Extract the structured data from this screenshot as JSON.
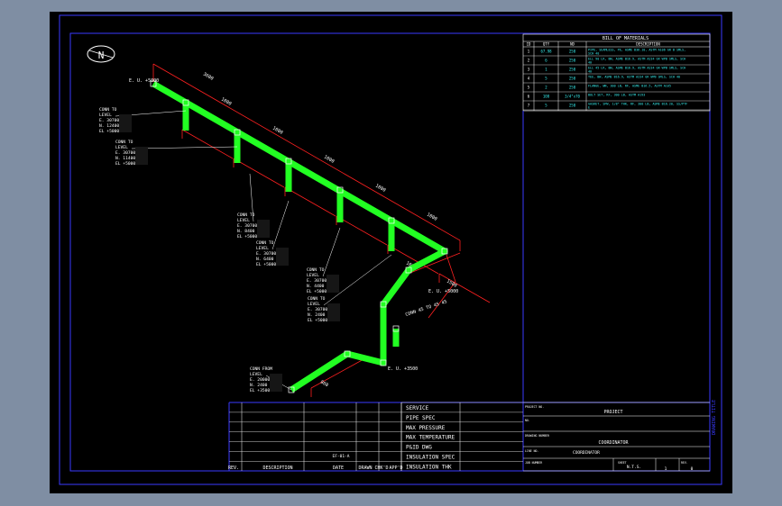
{
  "colors": {
    "background": "#000000",
    "frame": "#3a3aff",
    "pipe": "#22ff22",
    "dimension": "#ff2020",
    "text": "#ffffff",
    "bom_text": "#38f0f0"
  },
  "north_label": "N",
  "bom": {
    "title": "BILL OF MATERIALS",
    "headers": [
      "ID",
      "QTY",
      "ND",
      "DESCRIPTION"
    ],
    "rows": [
      [
        "1",
        "67.98",
        "250",
        "PIPE, SEAMLESS, PE, ASME B36.10, ASTM A106 GR B SMLS, SCH 40"
      ],
      [
        "2",
        "6",
        "250",
        "ELL 90 LR, BW, ASME B16.9, ASTM A234 GR WPB SMLS, SCH 40"
      ],
      [
        "3",
        "1",
        "250",
        "ELL 45 LR, BW, ASME B16.9, ASTM A234 GR WPB SMLS, SCH 40"
      ],
      [
        "4",
        "5",
        "250",
        "TEE, BW, ASME B16.9, ASTM A234 GR WPB SMLS, SCH 40"
      ],
      [
        "5",
        "2",
        "250",
        "FLANGE, WN, 300 LB, RF, ASME B16.5, ASTM A105"
      ],
      [
        "6",
        "108",
        "3/4\"x70",
        "BOLT SET, RF, 300 LB, ASTM A193"
      ],
      [
        "7",
        "5",
        "250",
        "GASKET, SPW, 1/8\" THK, RF, 300 LB, ASME B16.20, SS/PTFE"
      ]
    ]
  },
  "callouts": [
    {
      "text": "CONN TO\nLEVEL\nE. 30700\nN. 12400\nEL +5000"
    },
    {
      "text": "CONN TO\nLEVEL\nE. 30700\nN. 11400\nEL +5000"
    },
    {
      "text": "CONN TO\nLEVEL\nE. 30700\nN. 8400\nEL +5000"
    },
    {
      "text": "CONN TO\nLEVEL\nE. 30700\nN. 6400\nEL +5000"
    },
    {
      "text": "CONN TO\nLEVEL\nE. 30700\nN. 4400\nEL +5000"
    },
    {
      "text": "CONN TO\nLEVEL\nE. 30700\nN. 2400\nEL +5000"
    },
    {
      "text": "CONN FROM\nLEVEL\nE. 20000\nN. 2400\nEL +3500"
    }
  ],
  "top_label": "E. U. +5000",
  "elbow_labels": [
    "E. U. +5000",
    "CONN 45 TO 45 45",
    "E. U. +3500"
  ],
  "dimension_labels": [
    "3600",
    "1000",
    "1000",
    "1000",
    "1000",
    "1000",
    "1000",
    "1500",
    "860"
  ],
  "title_block": {
    "fields": [
      "SERVICE",
      "PIPE SPEC",
      "MAX PRESSURE",
      "MAX TEMPERATURE",
      "P&ID DWG",
      "INSULATION SPEC",
      "INSULATION THK"
    ],
    "bottom_headers": [
      "REV.",
      "DESCRIPTION",
      "DATE",
      "DRAWN",
      "CHK'D",
      "APP'D"
    ],
    "project_label": "PROJECT NO.",
    "project_value": "PROJECT",
    "drawing_label": "DRAWING NUMBER",
    "drawing_value": "COORDINATOR",
    "line_label": "LINE NO.",
    "line_value": "COORDINATOR",
    "job_label": "JOB NUMBER",
    "sheet_label": "SHEET",
    "rev_label": "REV.",
    "sheet_value": "1",
    "rev_value": "0",
    "scale_value": "N.T.S.",
    "mid_stamp": "EF-01-A",
    "side_text": "DRAWING TITLE"
  }
}
